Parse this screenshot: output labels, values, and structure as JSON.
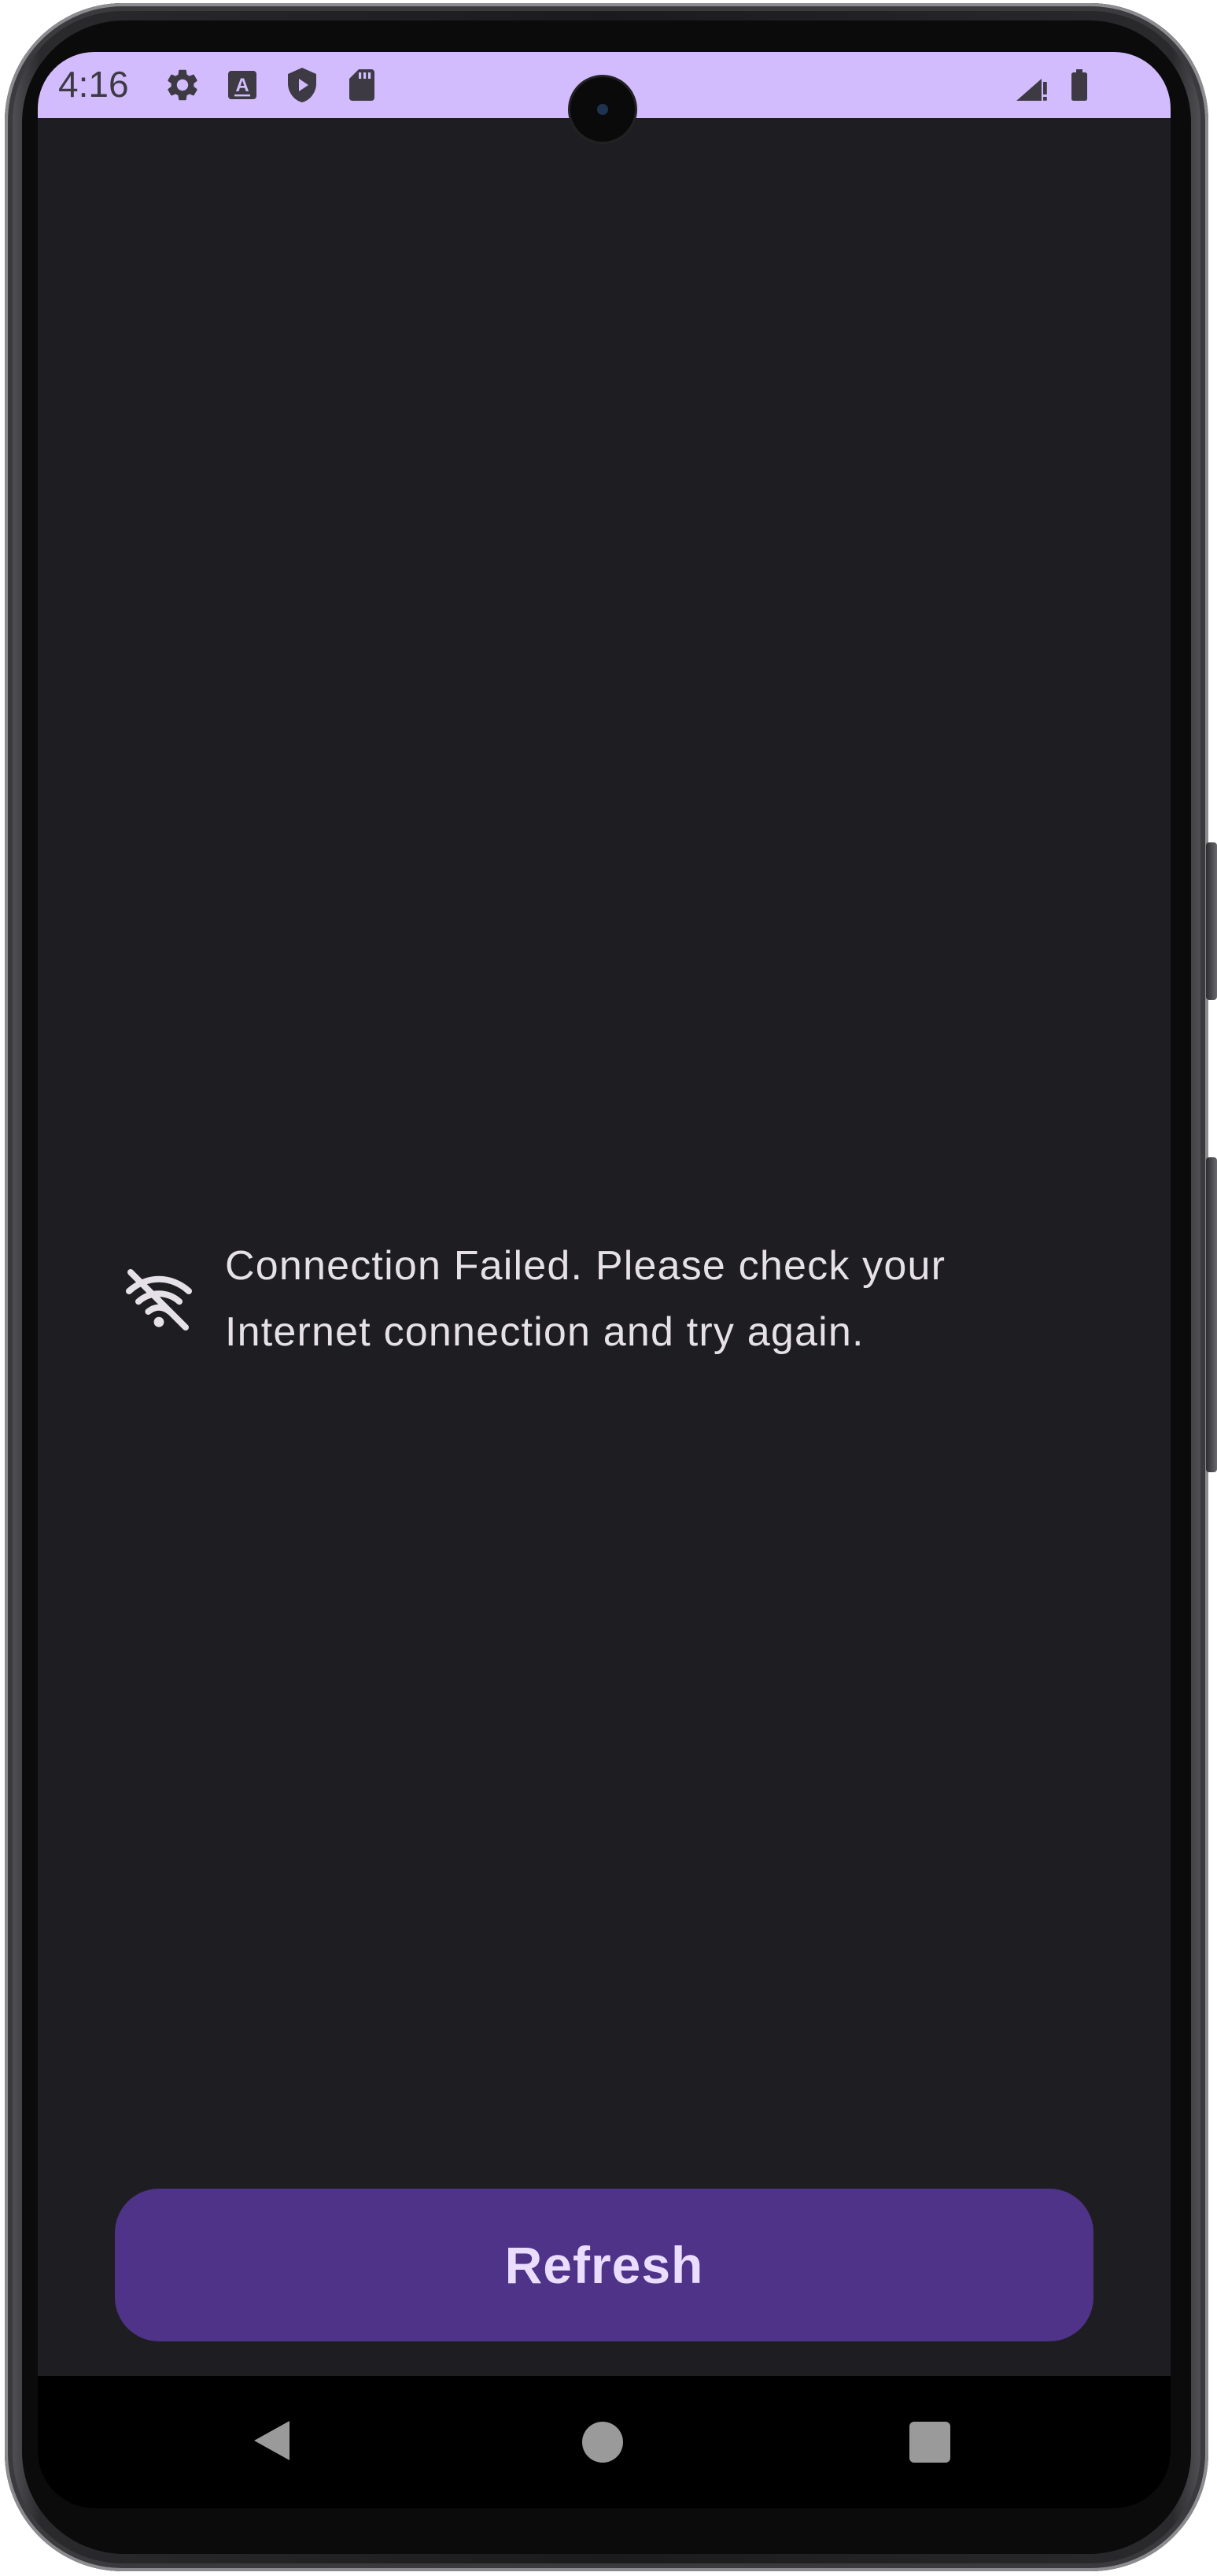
{
  "status_bar": {
    "time": "4:16",
    "background_color": "#d2bcfd",
    "left_icons": [
      "settings-icon",
      "keyboard-a-icon",
      "play-protect-icon",
      "sd-card-icon"
    ],
    "right_icons": [
      "cellular-no-data-icon",
      "battery-icon"
    ]
  },
  "main": {
    "error_icon": "wifi-off-icon",
    "error_message": "Connection Failed. Please check your Internet connection and try again.",
    "background_color": "#1e1d22",
    "text_color": "#e6e1e8"
  },
  "refresh_button": {
    "label": "Refresh",
    "background_color": "#4e3389",
    "text_color": "#eaddff"
  },
  "navigation_bar": {
    "buttons": [
      "back-icon",
      "home-icon",
      "recents-icon"
    ]
  }
}
